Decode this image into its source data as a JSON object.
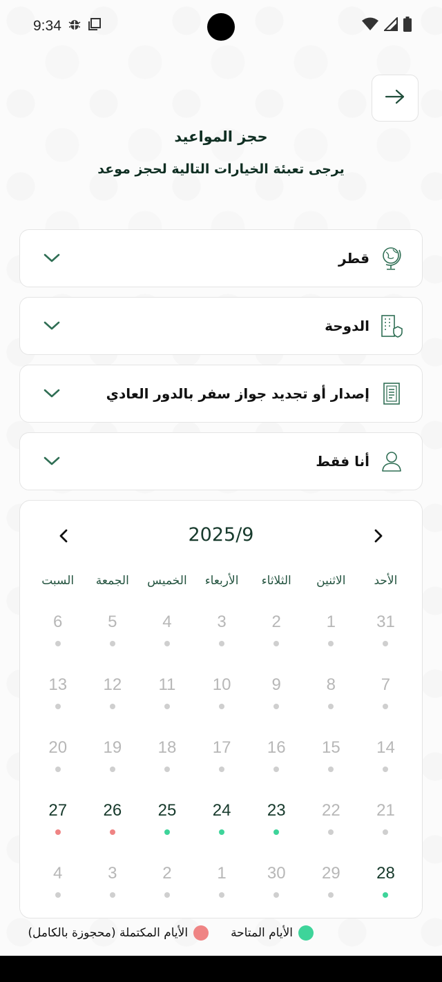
{
  "status_bar": {
    "time": "9:34"
  },
  "colors": {
    "primary": "#17352b",
    "available": "#3ed49a",
    "full": "#ef8484",
    "unavailable_dot": "#cfcfcf"
  },
  "header": {
    "title": "حجز المواعيد",
    "subtitle": "يرجى تعبئة الخيارات التالية لحجز موعد"
  },
  "selects": [
    {
      "icon": "globe-icon",
      "label": "قطر"
    },
    {
      "icon": "building-icon",
      "label": "الدوحة"
    },
    {
      "icon": "document-icon",
      "label": "إصدار أو تجديد جواز سفر بالدور العادي"
    },
    {
      "icon": "user-icon",
      "label": "أنا فقط"
    }
  ],
  "calendar": {
    "title": "2025/9",
    "weekdays": [
      "الأحد",
      "الاثنين",
      "الثلاثاء",
      "الأربعاء",
      "الخميس",
      "الجمعة",
      "السبت"
    ],
    "weeks": [
      [
        {
          "n": "31",
          "s": "none"
        },
        {
          "n": "1",
          "s": "none"
        },
        {
          "n": "2",
          "s": "none"
        },
        {
          "n": "3",
          "s": "none"
        },
        {
          "n": "4",
          "s": "none"
        },
        {
          "n": "5",
          "s": "none"
        },
        {
          "n": "6",
          "s": "none"
        }
      ],
      [
        {
          "n": "7",
          "s": "none"
        },
        {
          "n": "8",
          "s": "none"
        },
        {
          "n": "9",
          "s": "none"
        },
        {
          "n": "10",
          "s": "none"
        },
        {
          "n": "11",
          "s": "none"
        },
        {
          "n": "12",
          "s": "none"
        },
        {
          "n": "13",
          "s": "none"
        }
      ],
      [
        {
          "n": "14",
          "s": "none"
        },
        {
          "n": "15",
          "s": "none"
        },
        {
          "n": "16",
          "s": "none"
        },
        {
          "n": "17",
          "s": "none"
        },
        {
          "n": "18",
          "s": "none"
        },
        {
          "n": "19",
          "s": "none"
        },
        {
          "n": "20",
          "s": "none"
        }
      ],
      [
        {
          "n": "21",
          "s": "none"
        },
        {
          "n": "22",
          "s": "none"
        },
        {
          "n": "23",
          "s": "available"
        },
        {
          "n": "24",
          "s": "available"
        },
        {
          "n": "25",
          "s": "available"
        },
        {
          "n": "26",
          "s": "full"
        },
        {
          "n": "27",
          "s": "full"
        }
      ],
      [
        {
          "n": "28",
          "s": "available"
        },
        {
          "n": "29",
          "s": "none"
        },
        {
          "n": "30",
          "s": "none"
        },
        {
          "n": "1",
          "s": "none"
        },
        {
          "n": "2",
          "s": "none"
        },
        {
          "n": "3",
          "s": "none"
        },
        {
          "n": "4",
          "s": "none"
        }
      ]
    ]
  },
  "legend": {
    "available_label": "الأيام المتاحة",
    "full_label": "الأيام المكتملة (محجوزة بالكامل)"
  }
}
